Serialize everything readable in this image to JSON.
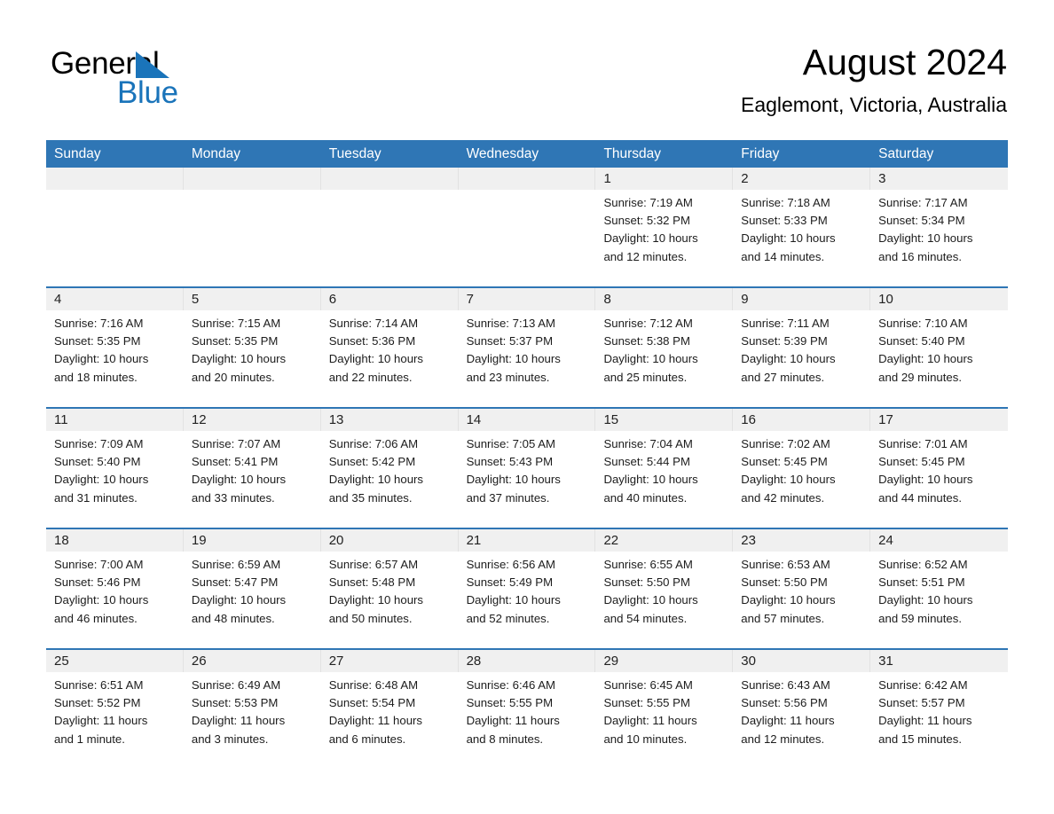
{
  "brand": {
    "name_part1": "General",
    "name_part2": "Blue",
    "triangle_color": "#1a74ba"
  },
  "header": {
    "title": "August 2024",
    "subtitle": "Eaglemont, Victoria, Australia"
  },
  "colors": {
    "header_band": "#2f76b5",
    "daynum_band": "#f0f0f0",
    "week_rule": "#2f76b5",
    "text": "#1c1c1c"
  },
  "weekdays": [
    "Sunday",
    "Monday",
    "Tuesday",
    "Wednesday",
    "Thursday",
    "Friday",
    "Saturday"
  ],
  "weeks": [
    [
      {
        "day": "",
        "sunrise": "",
        "sunset": "",
        "daylight_line1": "",
        "daylight_line2": ""
      },
      {
        "day": "",
        "sunrise": "",
        "sunset": "",
        "daylight_line1": "",
        "daylight_line2": ""
      },
      {
        "day": "",
        "sunrise": "",
        "sunset": "",
        "daylight_line1": "",
        "daylight_line2": ""
      },
      {
        "day": "",
        "sunrise": "",
        "sunset": "",
        "daylight_line1": "",
        "daylight_line2": ""
      },
      {
        "day": "1",
        "sunrise": "Sunrise: 7:19 AM",
        "sunset": "Sunset: 5:32 PM",
        "daylight_line1": "Daylight: 10 hours",
        "daylight_line2": "and 12 minutes."
      },
      {
        "day": "2",
        "sunrise": "Sunrise: 7:18 AM",
        "sunset": "Sunset: 5:33 PM",
        "daylight_line1": "Daylight: 10 hours",
        "daylight_line2": "and 14 minutes."
      },
      {
        "day": "3",
        "sunrise": "Sunrise: 7:17 AM",
        "sunset": "Sunset: 5:34 PM",
        "daylight_line1": "Daylight: 10 hours",
        "daylight_line2": "and 16 minutes."
      }
    ],
    [
      {
        "day": "4",
        "sunrise": "Sunrise: 7:16 AM",
        "sunset": "Sunset: 5:35 PM",
        "daylight_line1": "Daylight: 10 hours",
        "daylight_line2": "and 18 minutes."
      },
      {
        "day": "5",
        "sunrise": "Sunrise: 7:15 AM",
        "sunset": "Sunset: 5:35 PM",
        "daylight_line1": "Daylight: 10 hours",
        "daylight_line2": "and 20 minutes."
      },
      {
        "day": "6",
        "sunrise": "Sunrise: 7:14 AM",
        "sunset": "Sunset: 5:36 PM",
        "daylight_line1": "Daylight: 10 hours",
        "daylight_line2": "and 22 minutes."
      },
      {
        "day": "7",
        "sunrise": "Sunrise: 7:13 AM",
        "sunset": "Sunset: 5:37 PM",
        "daylight_line1": "Daylight: 10 hours",
        "daylight_line2": "and 23 minutes."
      },
      {
        "day": "8",
        "sunrise": "Sunrise: 7:12 AM",
        "sunset": "Sunset: 5:38 PM",
        "daylight_line1": "Daylight: 10 hours",
        "daylight_line2": "and 25 minutes."
      },
      {
        "day": "9",
        "sunrise": "Sunrise: 7:11 AM",
        "sunset": "Sunset: 5:39 PM",
        "daylight_line1": "Daylight: 10 hours",
        "daylight_line2": "and 27 minutes."
      },
      {
        "day": "10",
        "sunrise": "Sunrise: 7:10 AM",
        "sunset": "Sunset: 5:40 PM",
        "daylight_line1": "Daylight: 10 hours",
        "daylight_line2": "and 29 minutes."
      }
    ],
    [
      {
        "day": "11",
        "sunrise": "Sunrise: 7:09 AM",
        "sunset": "Sunset: 5:40 PM",
        "daylight_line1": "Daylight: 10 hours",
        "daylight_line2": "and 31 minutes."
      },
      {
        "day": "12",
        "sunrise": "Sunrise: 7:07 AM",
        "sunset": "Sunset: 5:41 PM",
        "daylight_line1": "Daylight: 10 hours",
        "daylight_line2": "and 33 minutes."
      },
      {
        "day": "13",
        "sunrise": "Sunrise: 7:06 AM",
        "sunset": "Sunset: 5:42 PM",
        "daylight_line1": "Daylight: 10 hours",
        "daylight_line2": "and 35 minutes."
      },
      {
        "day": "14",
        "sunrise": "Sunrise: 7:05 AM",
        "sunset": "Sunset: 5:43 PM",
        "daylight_line1": "Daylight: 10 hours",
        "daylight_line2": "and 37 minutes."
      },
      {
        "day": "15",
        "sunrise": "Sunrise: 7:04 AM",
        "sunset": "Sunset: 5:44 PM",
        "daylight_line1": "Daylight: 10 hours",
        "daylight_line2": "and 40 minutes."
      },
      {
        "day": "16",
        "sunrise": "Sunrise: 7:02 AM",
        "sunset": "Sunset: 5:45 PM",
        "daylight_line1": "Daylight: 10 hours",
        "daylight_line2": "and 42 minutes."
      },
      {
        "day": "17",
        "sunrise": "Sunrise: 7:01 AM",
        "sunset": "Sunset: 5:45 PM",
        "daylight_line1": "Daylight: 10 hours",
        "daylight_line2": "and 44 minutes."
      }
    ],
    [
      {
        "day": "18",
        "sunrise": "Sunrise: 7:00 AM",
        "sunset": "Sunset: 5:46 PM",
        "daylight_line1": "Daylight: 10 hours",
        "daylight_line2": "and 46 minutes."
      },
      {
        "day": "19",
        "sunrise": "Sunrise: 6:59 AM",
        "sunset": "Sunset: 5:47 PM",
        "daylight_line1": "Daylight: 10 hours",
        "daylight_line2": "and 48 minutes."
      },
      {
        "day": "20",
        "sunrise": "Sunrise: 6:57 AM",
        "sunset": "Sunset: 5:48 PM",
        "daylight_line1": "Daylight: 10 hours",
        "daylight_line2": "and 50 minutes."
      },
      {
        "day": "21",
        "sunrise": "Sunrise: 6:56 AM",
        "sunset": "Sunset: 5:49 PM",
        "daylight_line1": "Daylight: 10 hours",
        "daylight_line2": "and 52 minutes."
      },
      {
        "day": "22",
        "sunrise": "Sunrise: 6:55 AM",
        "sunset": "Sunset: 5:50 PM",
        "daylight_line1": "Daylight: 10 hours",
        "daylight_line2": "and 54 minutes."
      },
      {
        "day": "23",
        "sunrise": "Sunrise: 6:53 AM",
        "sunset": "Sunset: 5:50 PM",
        "daylight_line1": "Daylight: 10 hours",
        "daylight_line2": "and 57 minutes."
      },
      {
        "day": "24",
        "sunrise": "Sunrise: 6:52 AM",
        "sunset": "Sunset: 5:51 PM",
        "daylight_line1": "Daylight: 10 hours",
        "daylight_line2": "and 59 minutes."
      }
    ],
    [
      {
        "day": "25",
        "sunrise": "Sunrise: 6:51 AM",
        "sunset": "Sunset: 5:52 PM",
        "daylight_line1": "Daylight: 11 hours",
        "daylight_line2": "and 1 minute."
      },
      {
        "day": "26",
        "sunrise": "Sunrise: 6:49 AM",
        "sunset": "Sunset: 5:53 PM",
        "daylight_line1": "Daylight: 11 hours",
        "daylight_line2": "and 3 minutes."
      },
      {
        "day": "27",
        "sunrise": "Sunrise: 6:48 AM",
        "sunset": "Sunset: 5:54 PM",
        "daylight_line1": "Daylight: 11 hours",
        "daylight_line2": "and 6 minutes."
      },
      {
        "day": "28",
        "sunrise": "Sunrise: 6:46 AM",
        "sunset": "Sunset: 5:55 PM",
        "daylight_line1": "Daylight: 11 hours",
        "daylight_line2": "and 8 minutes."
      },
      {
        "day": "29",
        "sunrise": "Sunrise: 6:45 AM",
        "sunset": "Sunset: 5:55 PM",
        "daylight_line1": "Daylight: 11 hours",
        "daylight_line2": "and 10 minutes."
      },
      {
        "day": "30",
        "sunrise": "Sunrise: 6:43 AM",
        "sunset": "Sunset: 5:56 PM",
        "daylight_line1": "Daylight: 11 hours",
        "daylight_line2": "and 12 minutes."
      },
      {
        "day": "31",
        "sunrise": "Sunrise: 6:42 AM",
        "sunset": "Sunset: 5:57 PM",
        "daylight_line1": "Daylight: 11 hours",
        "daylight_line2": "and 15 minutes."
      }
    ]
  ]
}
